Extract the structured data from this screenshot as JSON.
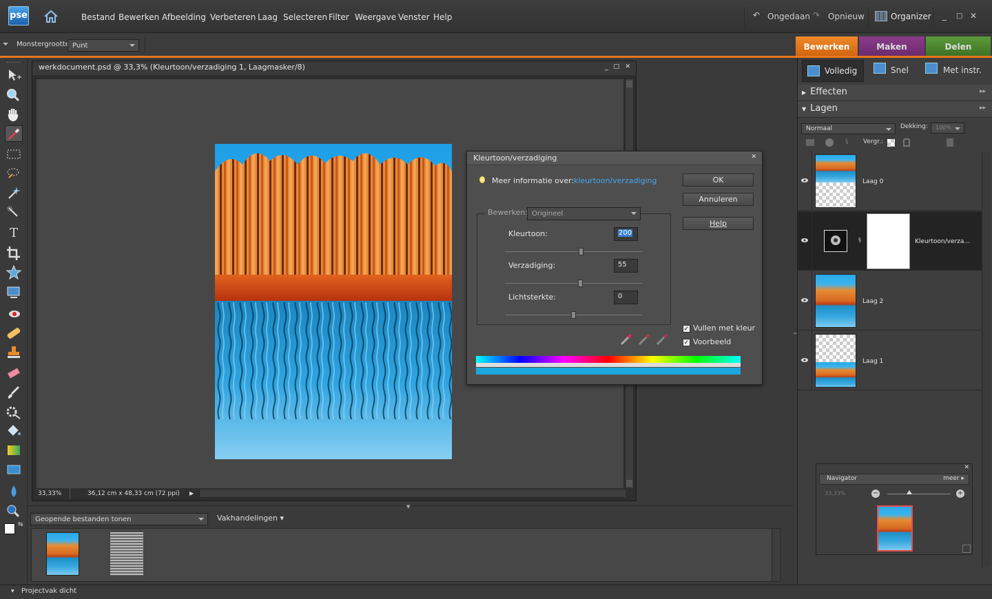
{
  "app": {
    "logo": "pse"
  },
  "menu": [
    "Bestand",
    "Bewerken",
    "Afbeelding",
    "Verbeteren",
    "Laag",
    "Selecteren",
    "Filter",
    "Weergave",
    "Venster",
    "Help"
  ],
  "toolbar_right": {
    "undo": "Ongedaan",
    "redo": "Opnieuw",
    "organizer": "Organizer"
  },
  "options": {
    "sample_size_label": "Monstergrootte:",
    "sample_size_value": "Punt"
  },
  "mode_tabs": [
    {
      "label": "Bewerken",
      "color": "#e87a1a"
    },
    {
      "label": "Maken",
      "color": "#8a3a8a"
    },
    {
      "label": "Delen",
      "color": "#4f8a2f"
    }
  ],
  "document": {
    "title": "werkdocument.psd @ 33,3% (Kleurtoon/verzadiging 1, Laagmasker/8)",
    "zoom": "33,33%",
    "size": "36,12 cm x 48,33 cm (72 ppi)"
  },
  "dialog": {
    "title": "Kleurtoon/verzadiging",
    "info_label": "Meer informatie over:",
    "info_link": "kleurtoon/verzadiging",
    "edit_label": "Bewerken:",
    "edit_value": "Origineel",
    "hue_label": "Kleurtoon:",
    "hue_value": "200",
    "sat_label": "Verzadiging:",
    "sat_value": "55",
    "light_label": "Lichtsterkte:",
    "light_value": "0",
    "ok": "OK",
    "cancel": "Annuleren",
    "help": "Help",
    "colorize": "Vullen met kleur",
    "preview": "Voorbeeld"
  },
  "right_panel": {
    "view_buttons": [
      "Volledig",
      "Snel",
      "Met instr."
    ],
    "effects": "Effecten",
    "layers": "Lagen",
    "blend_mode": "Normaal",
    "opacity_label": "Dekking:",
    "opacity_value": "100%",
    "lock_label": "Vergr.:",
    "layer_list": [
      {
        "name": "Laag 0"
      },
      {
        "name": "Kleurtoon/verza..."
      },
      {
        "name": "Laag 2"
      },
      {
        "name": "Laag 1"
      }
    ]
  },
  "navigator": {
    "title": "Navigator",
    "more": "meer",
    "zoom": "33,33%"
  },
  "bin": {
    "show_files": "Geopende bestanden tonen",
    "layouts": "Vakhandelingen"
  },
  "status": {
    "project_bin": "Projectvak dicht"
  }
}
